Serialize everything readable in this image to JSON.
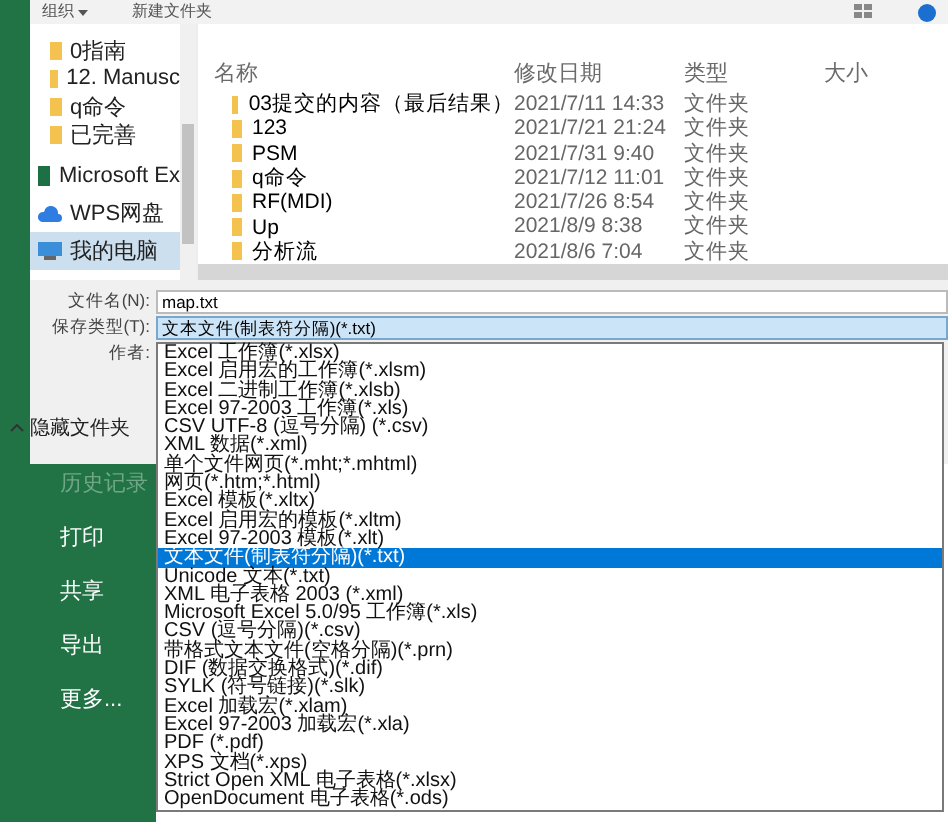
{
  "toolbar": [
    {
      "label": "组织",
      "dropdown": true
    },
    {
      "label": "新建文件夹",
      "dropdown": false
    }
  ],
  "nav": [
    {
      "label": "0指南",
      "kind": "folder",
      "selected": false
    },
    {
      "label": "12. Manusc",
      "kind": "folder",
      "selected": false
    },
    {
      "label": "q命令",
      "kind": "folder",
      "selected": false
    },
    {
      "label": "已完善",
      "kind": "folder",
      "selected": false
    },
    {
      "label": "Microsoft Ex",
      "kind": "excel",
      "selected": false
    },
    {
      "label": "WPS网盘",
      "kind": "cloud",
      "selected": false
    },
    {
      "label": "我的电脑",
      "kind": "computer",
      "selected": true
    }
  ],
  "columns": [
    "名称",
    "修改日期",
    "类型",
    "大小"
  ],
  "files": [
    {
      "name": "03提交的内容（最后结果）",
      "modified": "2021/7/11 14:33",
      "type": "文件夹"
    },
    {
      "name": "123",
      "modified": "2021/7/21 21:24",
      "type": "文件夹"
    },
    {
      "name": "PSM",
      "modified": "2021/7/31 9:40",
      "type": "文件夹"
    },
    {
      "name": "q命令",
      "modified": "2021/7/12 11:01",
      "type": "文件夹"
    },
    {
      "name": "RF(MDI)",
      "modified": "2021/7/26 8:54",
      "type": "文件夹"
    },
    {
      "name": "Up",
      "modified": "2021/8/9 8:38",
      "type": "文件夹"
    },
    {
      "name": "分析流",
      "modified": "2021/8/6 7:04",
      "type": "文件夹"
    }
  ],
  "form": {
    "file_name": {
      "label": "文件名(N):",
      "value": "map.txt"
    },
    "save_type": {
      "label": "保存类型(T):",
      "value": "文本文件(制表符分隔)(*.txt)"
    },
    "author": {
      "label": "作者:"
    }
  },
  "hide_folders": {
    "label": "隐藏文件夹"
  },
  "backstage": [
    {
      "label": "历史记录",
      "disabled": true
    },
    {
      "label": "打印",
      "disabled": false
    },
    {
      "label": "共享",
      "disabled": false
    },
    {
      "label": "导出",
      "disabled": false
    },
    {
      "label": "更多...",
      "disabled": false
    }
  ],
  "options": [
    {
      "label": "Excel 工作簿(*.xlsx)",
      "selected": false
    },
    {
      "label": "Excel 启用宏的工作簿(*.xlsm)",
      "selected": false
    },
    {
      "label": "Excel 二进制工作簿(*.xlsb)",
      "selected": false
    },
    {
      "label": "Excel 97-2003 工作簿(*.xls)",
      "selected": false
    },
    {
      "label": "CSV UTF-8 (逗号分隔) (*.csv)",
      "selected": false
    },
    {
      "label": "XML 数据(*.xml)",
      "selected": false
    },
    {
      "label": "单个文件网页(*.mht;*.mhtml)",
      "selected": false
    },
    {
      "label": "网页(*.htm;*.html)",
      "selected": false
    },
    {
      "label": "Excel 模板(*.xltx)",
      "selected": false
    },
    {
      "label": "Excel 启用宏的模板(*.xltm)",
      "selected": false
    },
    {
      "label": "Excel 97-2003 模板(*.xlt)",
      "selected": false
    },
    {
      "label": "文本文件(制表符分隔)(*.txt)",
      "selected": true
    },
    {
      "label": "Unicode 文本(*.txt)",
      "selected": false
    },
    {
      "label": "XML 电子表格 2003 (*.xml)",
      "selected": false
    },
    {
      "label": "Microsoft Excel 5.0/95 工作簿(*.xls)",
      "selected": false
    },
    {
      "label": "CSV (逗号分隔)(*.csv)",
      "selected": false
    },
    {
      "label": "带格式文本文件(空格分隔)(*.prn)",
      "selected": false
    },
    {
      "label": "DIF (数据交换格式)(*.dif)",
      "selected": false
    },
    {
      "label": "SYLK (符号链接)(*.slk)",
      "selected": false
    },
    {
      "label": "Excel 加载宏(*.xlam)",
      "selected": false
    },
    {
      "label": "Excel 97-2003 加载宏(*.xla)",
      "selected": false
    },
    {
      "label": "PDF (*.pdf)",
      "selected": false
    },
    {
      "label": "XPS 文档(*.xps)",
      "selected": false
    },
    {
      "label": "Strict Open XML 电子表格(*.xlsx)",
      "selected": false
    },
    {
      "label": "OpenDocument 电子表格(*.ods)",
      "selected": false
    }
  ]
}
